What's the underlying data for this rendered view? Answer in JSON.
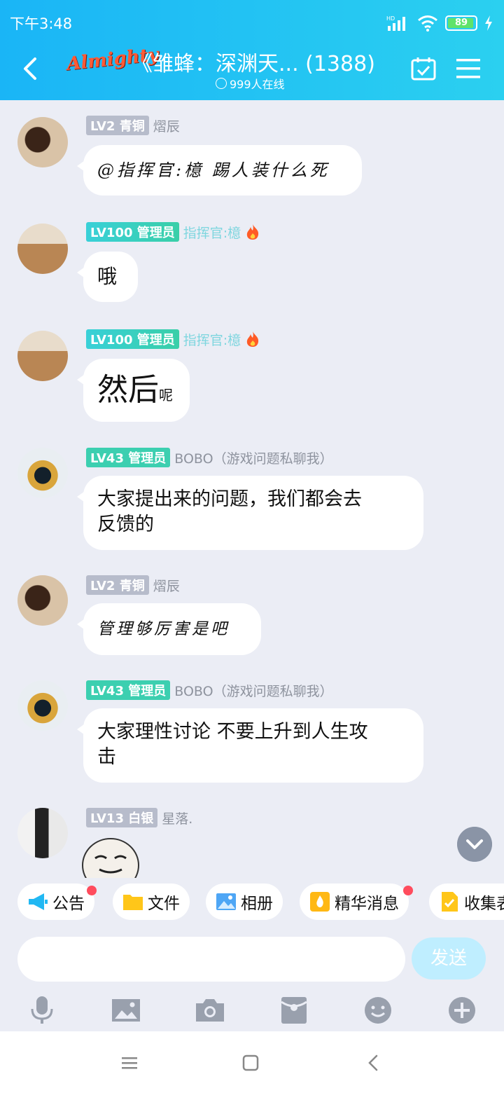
{
  "status_bar": {
    "time": "下午3:48",
    "battery": "89"
  },
  "header": {
    "logo_text": "Almighty",
    "title": "《雏蜂：深渊天... (1388)",
    "online": "999人在线"
  },
  "messages": [
    {
      "level": "LV2",
      "rank": "青铜",
      "nick": "熠辰",
      "text": "@指挥官:檍 踢人装什么死"
    },
    {
      "level": "LV100",
      "rank": "管理员",
      "nick": "指挥官:檍",
      "text": "哦"
    },
    {
      "level": "LV100",
      "rank": "管理员",
      "nick": "指挥官:檍",
      "text_big": "然后",
      "text_small": "呢"
    },
    {
      "level": "LV43",
      "rank": "管理员",
      "nick": "BOBO（游戏问题私聊我）",
      "text_line1": "大家提出来的问题，我们都会去",
      "text_line2": "反馈的"
    },
    {
      "level": "LV2",
      "rank": "青铜",
      "nick": "熠辰",
      "text": "管理够厉害是吧"
    },
    {
      "level": "LV43",
      "rank": "管理员",
      "nick": "BOBO（游戏问题私聊我）",
      "text_line1": "大家理性讨论 不要上升到人生攻",
      "text_line2": "击"
    },
    {
      "level": "LV13",
      "rank": "白银",
      "nick": "星落."
    }
  ],
  "quick_tags": [
    "公告",
    "文件",
    "相册",
    "精华消息",
    "收集表"
  ],
  "input": {
    "placeholder": "",
    "send_label": "发送"
  },
  "colors": {
    "header_start": "#1ab5f6",
    "header_end": "#2bd0f0",
    "background": "#ebedf5",
    "admin_badge": "#3ccfb0",
    "bronze_badge": "#b7bccb"
  }
}
